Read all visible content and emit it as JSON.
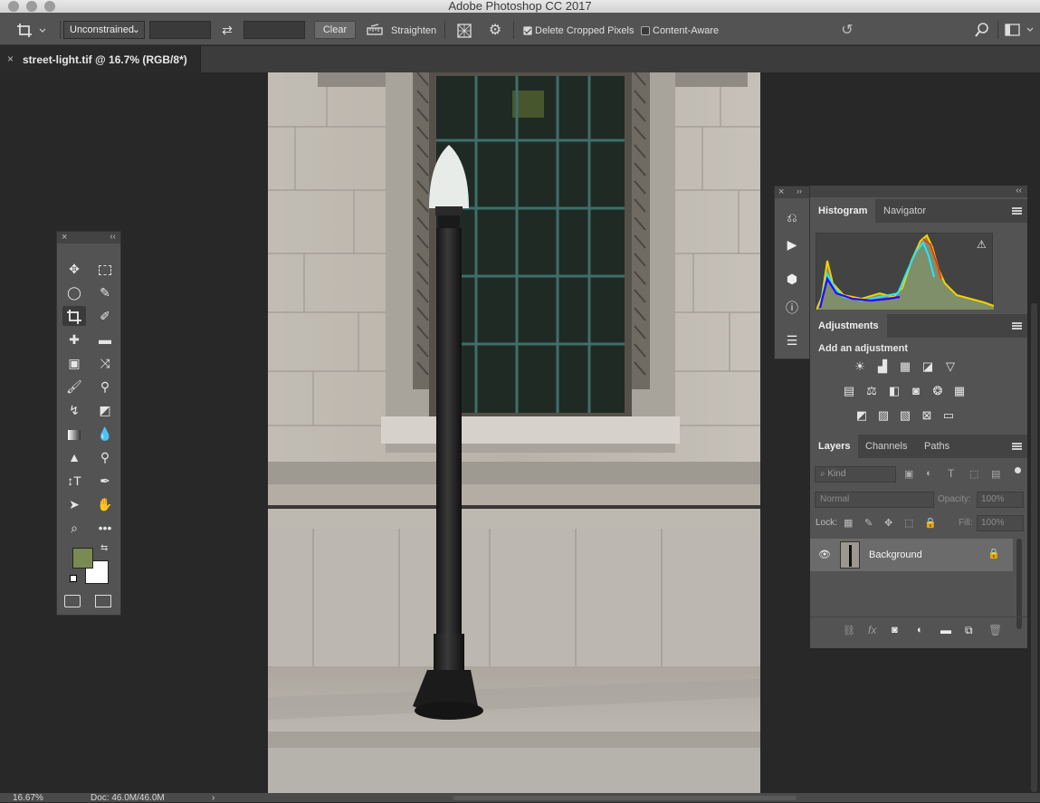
{
  "window": {
    "title": "Adobe Photoshop CC 2017"
  },
  "options_bar": {
    "ratio_preset": "Unconstrained",
    "clear_label": "Clear",
    "straighten_label": "Straighten",
    "delete_cropped_label": "Delete Cropped Pixels",
    "delete_cropped_checked": true,
    "content_aware_label": "Content-Aware",
    "content_aware_checked": false
  },
  "document_tab": {
    "label": "street-light.tif @ 16.7% (RGB/8*)"
  },
  "histogram_panel": {
    "tabs": [
      "Histogram",
      "Navigator"
    ],
    "active": "Histogram"
  },
  "adjustments_panel": {
    "tab": "Adjustments",
    "heading": "Add an adjustment"
  },
  "layers_panel": {
    "tabs": [
      "Layers",
      "Channels",
      "Paths"
    ],
    "active": "Layers",
    "filter_placeholder": "Kind",
    "blend_mode": "Normal",
    "opacity_label": "Opacity:",
    "opacity_value": "100%",
    "lock_label": "Lock:",
    "fill_label": "Fill:",
    "fill_value": "100%",
    "layers": [
      {
        "name": "Background",
        "visible": true,
        "locked": true
      }
    ]
  },
  "status_bar": {
    "zoom": "16.67%",
    "doc_info": "Doc: 46.0M/46.0M"
  },
  "colors": {
    "foreground": "#7b8a53",
    "background": "#ffffff",
    "accent_ui": "#535353"
  }
}
